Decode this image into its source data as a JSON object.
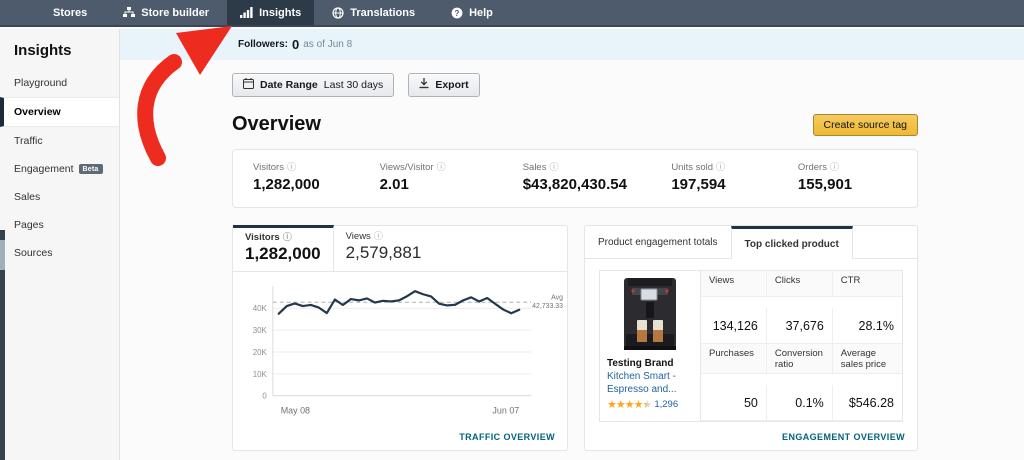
{
  "nav": {
    "items": [
      {
        "label": "Stores",
        "icon": null
      },
      {
        "label": "Store builder",
        "icon": "sitemap-icon"
      },
      {
        "label": "Insights",
        "icon": "bar-chart-icon",
        "active": true
      },
      {
        "label": "Translations",
        "icon": "globe-icon"
      },
      {
        "label": "Help",
        "icon": "help-icon"
      }
    ]
  },
  "followers_bar": {
    "label": "Followers:",
    "value": "0",
    "suffix": "as of Jun 8"
  },
  "sidebar": {
    "title": "Insights",
    "items": [
      {
        "label": "Playground"
      },
      {
        "label": "Overview",
        "active": true
      },
      {
        "label": "Traffic"
      },
      {
        "label": "Engagement",
        "badge": "Beta"
      },
      {
        "label": "Sales"
      },
      {
        "label": "Pages"
      },
      {
        "label": "Sources"
      }
    ]
  },
  "toolbar": {
    "date_range_label": "Date Range",
    "date_range_value": "Last 30 days",
    "export_label": "Export"
  },
  "page": {
    "title": "Overview",
    "create_source_tag_label": "Create source tag"
  },
  "stats": [
    {
      "label": "Visitors",
      "value": "1,282,000"
    },
    {
      "label": "Views/Visitor",
      "value": "2.01"
    },
    {
      "label": "Sales",
      "value": "$43,820,430.54"
    },
    {
      "label": "Units sold",
      "value": "197,594"
    },
    {
      "label": "Orders",
      "value": "155,901"
    }
  ],
  "traffic_card": {
    "tabs": [
      {
        "label": "Visitors",
        "value": "1,282,000",
        "active": true
      },
      {
        "label": "Views",
        "value": "2,579,881",
        "active": false
      }
    ],
    "footer_link": "TRAFFIC OVERVIEW"
  },
  "chart_data": {
    "type": "line",
    "title": "Visitors per day",
    "x_start_label": "May 08",
    "x_end_label": "Jun 07",
    "ylim": [
      0,
      50000
    ],
    "yticks": [
      0,
      10000,
      20000,
      30000,
      40000
    ],
    "ytick_labels": [
      "0",
      "10K",
      "20K",
      "30K",
      "40K"
    ],
    "avg": 42733.33,
    "avg_label_line1": "Avg",
    "avg_label_line2": "42,733.33",
    "grid": true,
    "series": [
      {
        "name": "Visitors",
        "values": [
          37500,
          41000,
          42200,
          41000,
          41500,
          40300,
          37800,
          44000,
          41500,
          44200,
          43600,
          44500,
          42600,
          43400,
          43100,
          43600,
          45500,
          47800,
          46400,
          45400,
          42100,
          41300,
          41600,
          43600,
          45000,
          43100,
          44700,
          42000,
          39400,
          37700,
          39300
        ]
      }
    ]
  },
  "engagement_card": {
    "tabs": [
      {
        "label": "Product engagement totals",
        "active": false
      },
      {
        "label": "Top clicked product",
        "active": true
      }
    ],
    "product": {
      "brand": "Testing Brand",
      "title": "Kitchen Smart - Espresso and...",
      "rating_count": "1,296",
      "stars": "4.5"
    },
    "table": {
      "rows": [
        [
          "Views",
          "Clicks",
          "CTR"
        ],
        [
          "134,126",
          "37,676",
          "28.1%"
        ],
        [
          "Purchases",
          "Conversion ratio",
          "Average sales price"
        ],
        [
          "50",
          "0.1%",
          "$546.28"
        ]
      ]
    },
    "footer_link": "ENGAGEMENT OVERVIEW"
  },
  "colors": {
    "nav_bg": "#4d5b6c",
    "nav_active_bg": "#2d3a47",
    "followers_bg": "#e8f3fa",
    "accent_yellow": "#eeb933",
    "link_teal": "#00637d",
    "product_link_blue": "#2162a1",
    "chart_line": "#24374b",
    "star_orange": "#ffa41c",
    "arrow_red": "#ee2b1f"
  }
}
